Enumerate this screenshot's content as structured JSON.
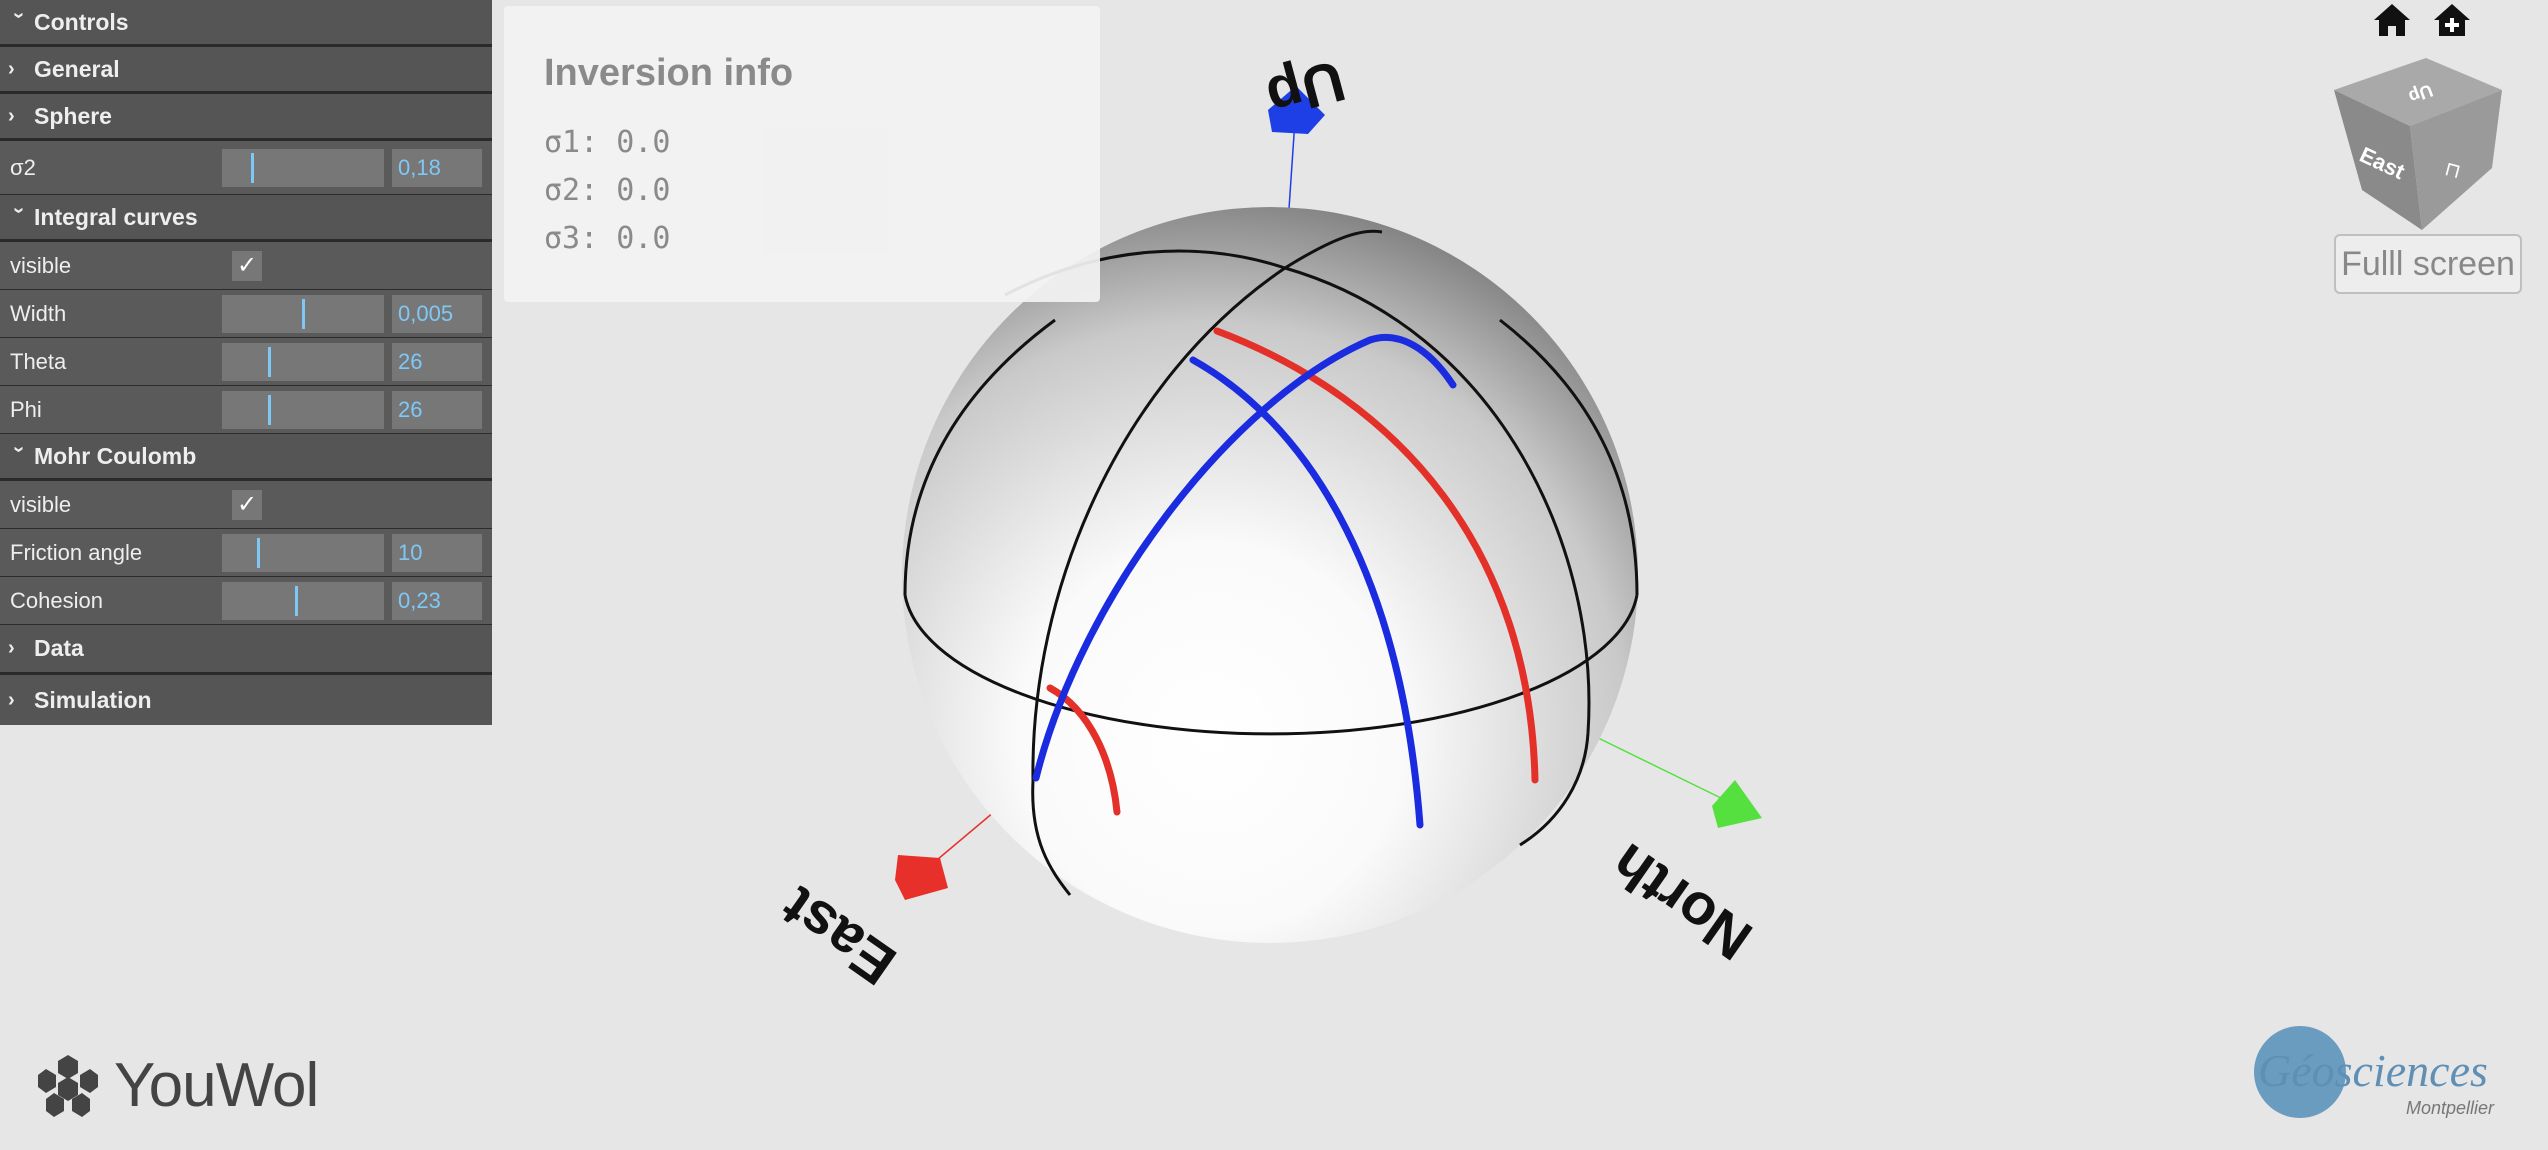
{
  "controls": {
    "title": "Controls",
    "general": "General",
    "sphere": "Sphere",
    "sigma2": {
      "label": "σ2",
      "value": "0,18",
      "fraction": 0.18
    },
    "integral_curves": {
      "title": "Integral curves",
      "visible_label": "visible",
      "visible": true,
      "width": {
        "label": "Width",
        "value": "0,005",
        "fraction": 0.5
      },
      "theta": {
        "label": "Theta",
        "value": "26",
        "fraction": 0.29
      },
      "phi": {
        "label": "Phi",
        "value": "26",
        "fraction": 0.29
      }
    },
    "mohr_coulomb": {
      "title": "Mohr Coulomb",
      "visible_label": "visible",
      "visible": true,
      "friction": {
        "label": "Friction angle",
        "value": "10",
        "fraction": 0.22
      },
      "cohesion": {
        "label": "Cohesion",
        "value": "0,23",
        "fraction": 0.46
      }
    },
    "data": "Data",
    "simulation": "Simulation"
  },
  "info": {
    "title": "Inversion info",
    "sigma1": "σ1: 0.0",
    "sigma2": "σ2: 0.0",
    "sigma3": "σ3: 0.0"
  },
  "scene": {
    "axis_up": "Up",
    "axis_east": "East",
    "axis_north": "North",
    "colors": {
      "up": "#1f3fe6",
      "east": "#e8302a",
      "north": "#55e040",
      "curve_blue": "#1a2be0",
      "curve_red": "#e3312a"
    }
  },
  "viewcube": {
    "face_up": "Up",
    "face_east": "East"
  },
  "fullscreen_label": "Fulll screen",
  "logos": {
    "youwol": "YouWol",
    "geo_main": "Géosciences",
    "geo_sub": "Montpellier"
  }
}
